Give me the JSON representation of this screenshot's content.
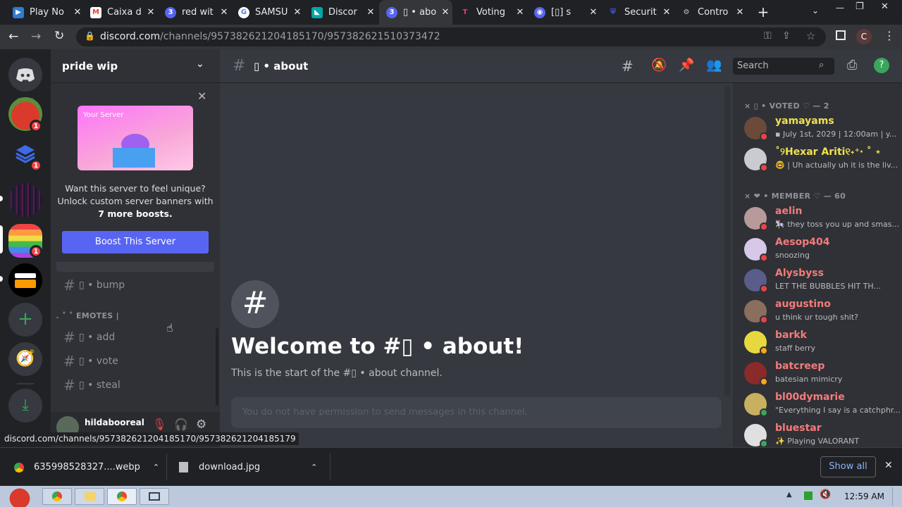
{
  "browser": {
    "tabs": [
      {
        "title": "Play No",
        "icon": "playstore-icon",
        "color": "#2b7cd3",
        "active": false
      },
      {
        "title": "Caixa d",
        "icon": "gmail-icon",
        "color": "#ea4335",
        "active": false
      },
      {
        "title": "red wit",
        "icon": "discord-unread-icon",
        "color": "#5865f2",
        "active": false
      },
      {
        "title": "SAMSU",
        "icon": "google-icon",
        "color": "#4285f4",
        "active": false
      },
      {
        "title": "Discor",
        "icon": "discord-app-icon",
        "color": "#00a8a8",
        "active": false
      },
      {
        "title": "▯ • abo",
        "icon": "discord-unread-icon",
        "color": "#5865f2",
        "active": true
      },
      {
        "title": "Voting",
        "icon": "top-gg-icon",
        "color": "#ff3366",
        "active": false
      },
      {
        "title": "[▯] s",
        "icon": "discord-icon",
        "color": "#5865f2",
        "active": false
      },
      {
        "title": "Securit",
        "icon": "shield-icon",
        "color": "#3d5afe",
        "active": false
      },
      {
        "title": "Contro",
        "icon": "gear-icon",
        "color": "#9aa0a6",
        "active": false
      }
    ],
    "url_host": "discord.com",
    "url_path": "/channels/957382621204185170/957382621510373472",
    "profile_initial": "C",
    "status_url": "discord.com/channels/957382621204185170/957382621204185179"
  },
  "discord": {
    "server_name": "pride wip",
    "server_badges": [
      "1",
      "1",
      "1"
    ],
    "boost": {
      "card_label": "Your Server",
      "line1": "Want this server to feel unique?",
      "line2": "Unlock custom server banners with",
      "line3": "7 more boosts.",
      "button": "Boost This Server"
    },
    "channels": [
      {
        "name": "▯ • bump"
      }
    ],
    "category": "˚ ˚ EMOTES |",
    "category_channels": [
      {
        "name": "▯ • add"
      },
      {
        "name": "▯ • vote"
      },
      {
        "name": "▯ • steal"
      }
    ],
    "user": {
      "name": "hildabooreal"
    },
    "channel_header": "▯ • about",
    "search_placeholder": "Search",
    "welcome_title": "Welcome to #▯ • about!",
    "welcome_sub": "This is the start of the #▯ • about channel.",
    "composer_placeholder": "You do not have permission to send messages in this channel.",
    "groups": [
      {
        "title": "× ▯ • VOTED ♡ — 2",
        "members": [
          {
            "name": "yamayams",
            "sub": "▪ July 1st, 2029 | 12:00am | y...",
            "color": "#f0e050",
            "avatar": "#6b4a3a",
            "status": "#ed4245"
          },
          {
            "name": "˚୨Hexar Ariti୧˖⁺‧ ˚ ⋆",
            "sub": "🤓 | Uh actually uh it is the liv...",
            "color": "#f0e050",
            "avatar": "#c9cbd0",
            "status": "#ed4245"
          }
        ]
      },
      {
        "title": "× ❤ • MEMBER ♡ — 60",
        "members": [
          {
            "name": "aelin",
            "sub": "🎠 they toss you up and smas...",
            "color": "#f47b7b",
            "avatar": "#b89a9a",
            "status": "#ed4245"
          },
          {
            "name": "Aesop404",
            "sub": "snoozing",
            "color": "#f47b7b",
            "avatar": "#d8c8e8",
            "status": "#ed4245"
          },
          {
            "name": "Alysbyss",
            "sub": "LET THE BUBBLES HIT TH...",
            "color": "#f47b7b",
            "avatar": "#5a5c8a",
            "status": "#ed4245"
          },
          {
            "name": "augustino",
            "sub": "u think ur tough shit?",
            "color": "#f47b7b",
            "avatar": "#8a6e5e",
            "status": "#ed4245"
          },
          {
            "name": "barkk",
            "sub": "staff berry",
            "color": "#f47b7b",
            "avatar": "#e8d840",
            "status": "#faa61a"
          },
          {
            "name": "batcreep",
            "sub": "batesian mimicry",
            "color": "#f47b7b",
            "avatar": "#8a2a2a",
            "status": "#faa61a"
          },
          {
            "name": "bl00dymarie",
            "sub": "\"Everything I say is a catchphr...",
            "color": "#f47b7b",
            "avatar": "#c8b060",
            "status": "#3ba55d"
          },
          {
            "name": "bluestar",
            "sub": "✨ Playing VALORANT",
            "color": "#f47b7b",
            "avatar": "#e0e0e0",
            "status": "#3ba55d"
          }
        ]
      }
    ]
  },
  "downloads": [
    {
      "name": "635998528327....webp"
    },
    {
      "name": "download.jpg"
    }
  ],
  "show_all": "Show all",
  "clock": "12:59 AM"
}
